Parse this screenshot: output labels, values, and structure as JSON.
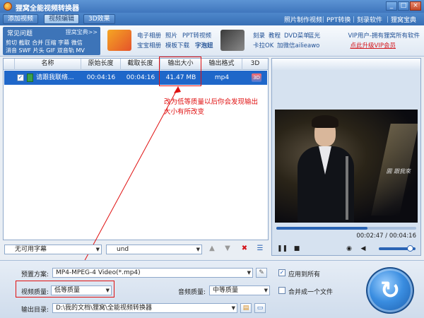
{
  "window": {
    "title": "狸窝全能视频转换器",
    "min": "_",
    "max": "□",
    "close": "×"
  },
  "menu": {
    "tabs": [
      "添加视频",
      "视频编辑",
      "3D效果"
    ],
    "links": [
      "照片制作视频",
      "PPT转换",
      "刻录软件",
      "狸窝宝典"
    ]
  },
  "banner": {
    "faq_title": "常见问题",
    "faq_more": "狸窝宝典>>",
    "faq_lines": [
      "剪切 截取 合并 压缩 字幕 微信",
      "消音 SWF 片头 GIF 双音轨 MV"
    ],
    "promo_group1": [
      "电子相册",
      "照片",
      "PPT转视频",
      "宝宝相册",
      "模板下载",
      "字泡妞"
    ],
    "promo_group2": [
      "刻录",
      "教程",
      "DVD菜单",
      "蓝光",
      "卡拉OK",
      "加微信ailieawo"
    ],
    "vip_line1": "VIP用户-拥有狸窝所有软件",
    "vip_line2": "点此升级VIP会员"
  },
  "file_list": {
    "columns": [
      "名称",
      "原始长度",
      "截取长度",
      "输出大小",
      "输出格式",
      "3D"
    ],
    "rows": [
      {
        "checked": "✓",
        "name": "请跟我联络...",
        "original_length": "00:04:16",
        "clip_length": "00:04:16",
        "output_size": "41.47 MB",
        "output_format": "mp4",
        "three_d": "3D"
      }
    ]
  },
  "annotation": {
    "text": "改为低等质量以后你会发现输出大小有所改变",
    "color": "#e01010"
  },
  "preview": {
    "time": "00:02:47 / 00:04:16",
    "progress": 0.65,
    "watermark": "圓 跟我來"
  },
  "list_tools": {
    "subtitle": "无可用字幕",
    "audio_track": "und"
  },
  "settings": {
    "preset_label": "预置方案:",
    "preset_value": "MP4-MPEG-4 Video(*.mp4)",
    "apply_all_label": "应用到所有",
    "apply_all_checked": "✓",
    "video_quality_label": "视频质量:",
    "video_quality_value": "低等质量",
    "audio_quality_label": "音频质量:",
    "audio_quality_value": "中等质量",
    "merge_label": "合并成一个文件",
    "output_dir_label": "输出目录:",
    "output_dir_value": "D:\\我的文档\\狸窝\\全能视频转换器"
  },
  "icons": {
    "settings": "wrench-icon",
    "folder": "folder-icon",
    "convert": "convert-icon"
  },
  "colors": {
    "accent": "#3f76bd",
    "highlight": "#1f67c9",
    "annotation": "#e01010"
  }
}
